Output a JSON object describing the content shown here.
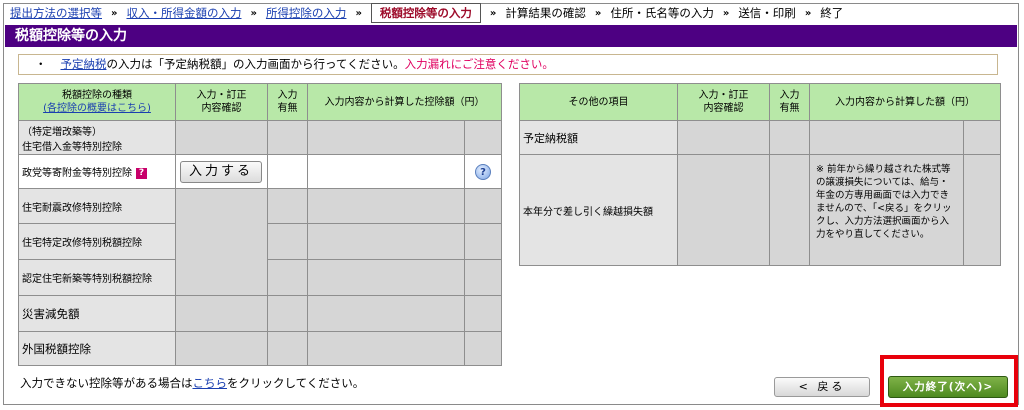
{
  "breadcrumb": {
    "items": [
      {
        "label": "提出方法の選択等",
        "state": "link"
      },
      {
        "label": "収入・所得金額の入力",
        "state": "link"
      },
      {
        "label": "所得控除の入力",
        "state": "link"
      },
      {
        "label": "税額控除等の入力",
        "state": "current"
      },
      {
        "label": "計算結果の確認",
        "state": "plain"
      },
      {
        "label": "住所・氏名等の入力",
        "state": "plain"
      },
      {
        "label": "送信・印刷",
        "state": "plain"
      },
      {
        "label": "終了",
        "state": "plain"
      }
    ],
    "separator": "»"
  },
  "page_title": "税額控除等の入力",
  "notice": {
    "bullet": "・",
    "link": "予定納税",
    "text": "の入力は「予定納税額」の入力画面から行ってください。",
    "warning": "入力漏れにご注意ください。"
  },
  "left_table": {
    "header_col1_line1": "税額控除の種類",
    "header_col1_link": "(各控除の概要はこちら)",
    "header_col2": "入力・訂正\n内容確認",
    "header_col3": "入力\n有無",
    "header_col4": "入力内容から計算した控除額（円）",
    "rows": {
      "r1_line1": "（特定増改築等）",
      "r1_line2": "住宅借入金等特別控除",
      "r2": "政党等寄附金等特別控除",
      "r2_help": "?",
      "r2_button": "入力する",
      "r2_qicon": "?",
      "r3": "住宅耐震改修特別控除",
      "r4": "住宅特定改修特別税額控除",
      "r5": "認定住宅新築等特別税額控除",
      "r6": "災害減免額",
      "r7": "外国税額控除"
    }
  },
  "right_table": {
    "header_col1": "その他の項目",
    "header_col2": "入力・訂正\n内容確認",
    "header_col3": "入力\n有無",
    "header_col4": "入力内容から計算した額（円）",
    "row1": "予定納税額",
    "row2": "本年分で差し引く繰越損失額",
    "row2_note": "※ 前年から繰り越された株式等の譲渡損失については、給与・年金の方専用画面では入力できませんので、「<戻る」をクリックし、入力方法選択画面から入力をやり直してください。"
  },
  "bottom": {
    "text_before": "入力できない控除等がある場合は",
    "link": "こちら",
    "text_after": "をクリックしてください。"
  },
  "buttons": {
    "back": "< 戻る",
    "next": "入力終了(次へ)>"
  },
  "colors": {
    "title_bg": "#4d0082",
    "header_bg": "#b8e8a8",
    "current_step": "#9d0b2a",
    "warning": "#e00060",
    "highlight_box": "#e8000b",
    "next_button": "#5e9a2a"
  }
}
